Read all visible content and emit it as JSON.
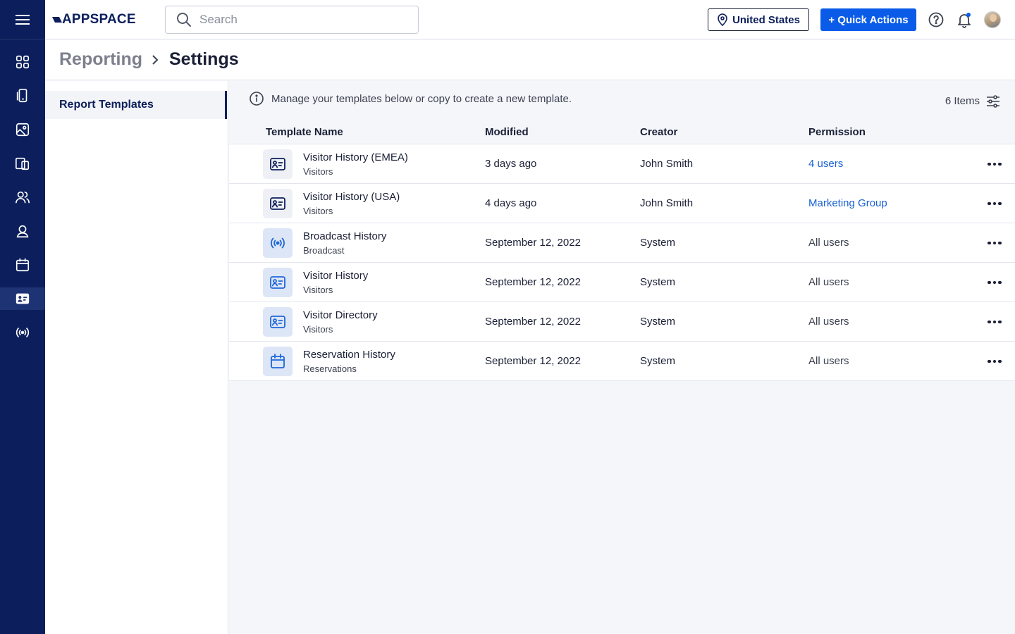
{
  "header": {
    "logo_text": "APPSPACE",
    "search_placeholder": "Search",
    "location_label": "United States",
    "quick_actions_label": "+ Quick Actions"
  },
  "rail": {
    "items": [
      {
        "icon": "dashboard-grid-icon"
      },
      {
        "icon": "mobile-device-icon"
      },
      {
        "icon": "image-icon"
      },
      {
        "icon": "screens-icon"
      },
      {
        "icon": "people-icon"
      },
      {
        "icon": "employee-badge-icon"
      },
      {
        "icon": "calendar-icon"
      },
      {
        "icon": "visitor-card-icon",
        "active": true
      },
      {
        "icon": "broadcast-icon"
      }
    ]
  },
  "breadcrumb": {
    "parent": "Reporting",
    "current": "Settings"
  },
  "subnav": {
    "items": [
      {
        "label": "Report Templates",
        "active": true
      }
    ]
  },
  "main": {
    "info_text": "Manage your templates below or copy to create a new template.",
    "items_count": "6 Items",
    "columns": {
      "name": "Template Name",
      "modified": "Modified",
      "creator": "Creator",
      "permission": "Permission"
    },
    "rows": [
      {
        "name": "Visitor History (EMEA)",
        "category": "Visitors",
        "modified": "3 days ago",
        "creator": "John Smith",
        "permission": "4 users",
        "permission_is_link": true,
        "icon": "visitor-card-icon",
        "tile": "dark"
      },
      {
        "name": "Visitor History (USA)",
        "category": "Visitors",
        "modified": "4 days ago",
        "creator": "John Smith",
        "permission": "Marketing Group",
        "permission_is_link": true,
        "icon": "visitor-card-icon",
        "tile": "dark"
      },
      {
        "name": "Broadcast History",
        "category": "Broadcast",
        "modified": "September 12, 2022",
        "creator": "System",
        "permission": "All users",
        "permission_is_link": false,
        "icon": "broadcast-icon",
        "tile": "blue"
      },
      {
        "name": "Visitor History",
        "category": "Visitors",
        "modified": "September 12, 2022",
        "creator": "System",
        "permission": "All users",
        "permission_is_link": false,
        "icon": "visitor-card-icon",
        "tile": "blue"
      },
      {
        "name": "Visitor Directory",
        "category": "Visitors",
        "modified": "September 12, 2022",
        "creator": "System",
        "permission": "All users",
        "permission_is_link": false,
        "icon": "visitor-card-icon",
        "tile": "blue"
      },
      {
        "name": "Reservation History",
        "category": "Reservations",
        "modified": "September 12, 2022",
        "creator": "System",
        "permission": "All users",
        "permission_is_link": false,
        "icon": "calendar-icon",
        "tile": "blue"
      }
    ]
  },
  "colors": {
    "rail_bg": "#0c1f5c",
    "primary_button": "#0a5ce8",
    "link": "#1760d4",
    "icon_blue": "#1f66d8",
    "icon_dark": "#0c1f5c"
  }
}
